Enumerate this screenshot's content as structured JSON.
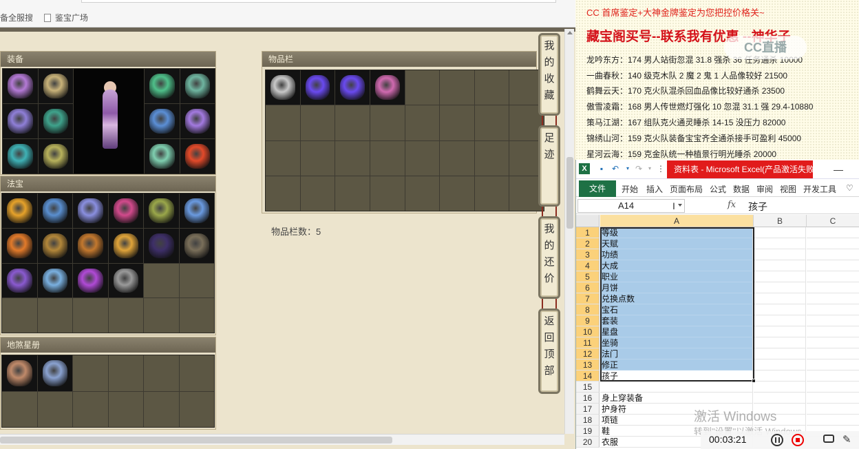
{
  "browser": {
    "bookmarks": [
      "备全服搜",
      "鉴宝广场"
    ]
  },
  "game": {
    "equip_title": "装备",
    "fabao_title": "法宝",
    "star_title": "地煞星册",
    "bag_title": "物品栏",
    "bag_count": "物品栏数：5",
    "side_tabs": [
      {
        "chars": [
          "我",
          "的",
          "收",
          "藏"
        ]
      },
      {
        "chars": [
          "足",
          "迹"
        ]
      },
      {
        "chars": [
          "我",
          "的",
          "还",
          "价"
        ]
      },
      {
        "chars": [
          "返",
          "回",
          "顶",
          "部"
        ]
      }
    ],
    "equip_items": [
      {
        "color": "#b47ad6"
      },
      {
        "color": "#c9b37a"
      },
      null,
      null,
      {
        "color": "#4fc08a"
      },
      {
        "color": "#6fb5a0"
      },
      {
        "color": "#8f7fd8"
      },
      {
        "color": "#3fa38c"
      },
      null,
      null,
      {
        "color": "#5b8fd6"
      },
      {
        "color": "#a37ae0"
      },
      {
        "color": "#3fb2b6"
      },
      {
        "color": "#b8b25c"
      },
      null,
      null,
      {
        "color": "#7fcfb0"
      },
      {
        "color": "#e34a2a"
      }
    ],
    "fabao_items": [
      {
        "color": "#e6a22a"
      },
      {
        "color": "#5a8fd0"
      },
      {
        "color": "#8a8fe0"
      },
      {
        "color": "#d24a8c"
      },
      {
        "color": "#9aa74a"
      },
      {
        "color": "#6a9ae0"
      },
      {
        "color": "#e27a2a"
      },
      {
        "color": "#b3873a"
      },
      {
        "color": "#c3782e"
      },
      {
        "color": "#e0a43a"
      },
      {
        "color": "#3e2f68"
      },
      {
        "color": "#7a6f5a"
      },
      {
        "color": "#8a5ad0"
      },
      {
        "color": "#7ab0e0"
      },
      {
        "color": "#b04ad6"
      },
      {
        "color": "#9a9a9a"
      },
      null,
      null,
      null,
      null,
      null,
      null,
      null,
      null
    ],
    "star_items": [
      {
        "color": "#c08a6a"
      },
      {
        "color": "#8aa2d0"
      },
      null,
      null,
      null,
      null,
      null,
      null,
      null,
      null,
      null,
      null
    ],
    "bag_items": [
      {
        "color": "#c9c9c9"
      },
      {
        "color": "#6a4af0"
      },
      {
        "color": "#6a4af0"
      },
      {
        "color": "#d06ab0"
      },
      null,
      null,
      null,
      null,
      null,
      null,
      null,
      null,
      null,
      null,
      null,
      null,
      null,
      null,
      null,
      null,
      null,
      null,
      null,
      null,
      null,
      null,
      null,
      null,
      null,
      null,
      null,
      null
    ]
  },
  "doc": {
    "ad_line": "CC 首席鉴定+大神金牌鉴定为您把控价格关~",
    "headline": "藏宝阁买号--联系我有优惠 --神华子",
    "watermark": "CC直播",
    "lines": [
      "龙吟东方：174 男人站街忽混 31.8 强杀 36 任务通杀 10000",
      "一曲春秋：140 级克木队 2 魔 2 鬼 1 人品像较好 21500",
      "鹤舞云天：170 克火队混杀回血品像比较好通杀 23500",
      "傲雪凌霜：168 男人传世燃灯强化 10 忽混 31.1 强 29.4-10880",
      "策马江湖：167 组队克火通灵睡杀 14-15 没压力 82000",
      "锦绣山河：159 克火队装备宝宝齐全通杀接手可盈利 45000",
      "星河云海：159 克金队统一种植景行明光睡杀 20000"
    ]
  },
  "excel": {
    "logo": "X",
    "caption": "资料表 - Microsoft Excel(产品激活失败)",
    "ribbon_tabs": [
      "文件",
      "开始",
      "插入",
      "页面布局",
      "公式",
      "数据",
      "审阅",
      "视图",
      "开发工具"
    ],
    "name_box": "A14",
    "formula_value": "孩子",
    "fx": "fx",
    "columns": [
      "A",
      "B",
      "C"
    ],
    "rows": [
      {
        "n": "1",
        "a": "等级",
        "sel": true
      },
      {
        "n": "2",
        "a": "天赋",
        "sel": true
      },
      {
        "n": "3",
        "a": "功绩",
        "sel": true
      },
      {
        "n": "4",
        "a": "大成",
        "sel": true
      },
      {
        "n": "5",
        "a": "职业",
        "sel": true
      },
      {
        "n": "6",
        "a": "月饼",
        "sel": true
      },
      {
        "n": "7",
        "a": "兑换点数",
        "sel": true
      },
      {
        "n": "8",
        "a": "宝石",
        "sel": true
      },
      {
        "n": "9",
        "a": "套装",
        "sel": true
      },
      {
        "n": "10",
        "a": "星盘",
        "sel": true
      },
      {
        "n": "11",
        "a": "坐骑",
        "sel": true
      },
      {
        "n": "12",
        "a": "法门",
        "sel": true
      },
      {
        "n": "13",
        "a": "修正",
        "sel": true
      },
      {
        "n": "14",
        "a": "孩子",
        "sel": false,
        "active": true
      },
      {
        "n": "15",
        "a": "",
        "sel": false
      },
      {
        "n": "16",
        "a": "身上穿装备",
        "sel": false
      },
      {
        "n": "17",
        "a": "护身符",
        "sel": false
      },
      {
        "n": "18",
        "a": "项链",
        "sel": false
      },
      {
        "n": "19",
        "a": "鞋",
        "sel": false
      },
      {
        "n": "20",
        "a": "衣服",
        "sel": false
      }
    ]
  },
  "os": {
    "activate": "激活 Windows",
    "activate_sub": "转到\"设置\"以激活 Windows。"
  },
  "recorder": {
    "time": "00:03:21"
  }
}
